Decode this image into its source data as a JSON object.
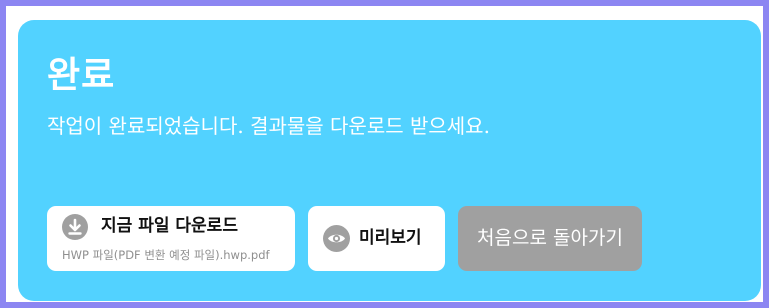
{
  "dialog": {
    "title": "완료",
    "message": "작업이 완료되었습니다. 결과물을 다운로드 받으세요."
  },
  "buttons": {
    "download": {
      "label": "지금 파일 다운로드",
      "filename": "HWP 파일(PDF 변환 예정 파일).hwp.pdf",
      "icon": "download-icon"
    },
    "preview": {
      "label": "미리보기",
      "icon": "eye-icon"
    },
    "home": {
      "label": "처음으로 돌아가기"
    }
  },
  "colors": {
    "frame_border": "#8c86f2",
    "card_background": "#52d2ff",
    "button_background": "#ffffff",
    "home_button_background": "#a0a0a0",
    "icon_background": "#a0a0a0"
  }
}
